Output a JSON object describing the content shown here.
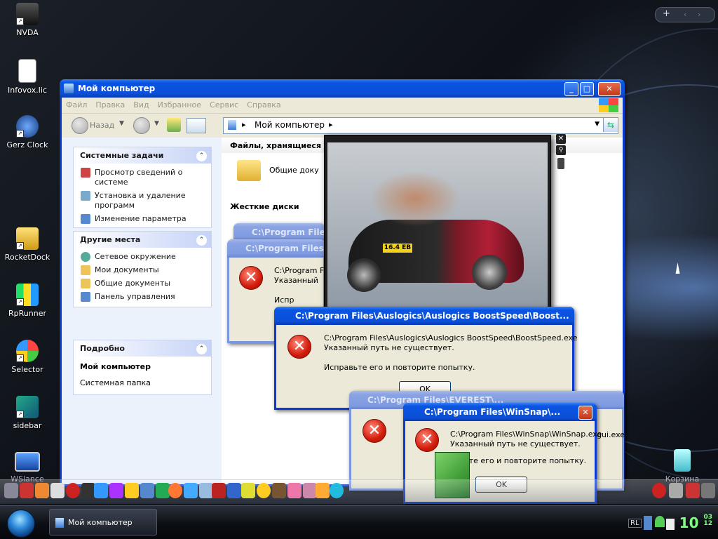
{
  "desktop_icons": [
    {
      "label": "NVDA",
      "icon": "nvda-icon"
    },
    {
      "label": "Infovox.lic",
      "icon": "document-icon"
    },
    {
      "label": "Gerz Clock",
      "icon": "clock-icon"
    },
    {
      "label": "RocketDock",
      "icon": "rocketdock-icon"
    },
    {
      "label": "RpRunner",
      "icon": "rprunner-icon"
    },
    {
      "label": "Selector",
      "icon": "windows-orb-icon"
    },
    {
      "label": "sidebar",
      "icon": "sidebar-icon"
    },
    {
      "label": "WSlance",
      "icon": "monitor-icon"
    },
    {
      "label": "Корзина",
      "icon": "recycle-bin-icon"
    }
  ],
  "explorer": {
    "title": "Мой компьютер",
    "menu": [
      "Файл",
      "Правка",
      "Вид",
      "Избранное",
      "Сервис",
      "Справка"
    ],
    "back_label": "Назад",
    "address": "Мой компьютер",
    "groups": [
      {
        "title": "Системные задачи",
        "items": [
          "Просмотр сведений о системе",
          "Установка и удаление программ",
          "Изменение параметра"
        ]
      },
      {
        "title": "Другие места",
        "items": [
          "Сетевое окружение",
          "Мои документы",
          "Общие документы",
          "Панель управления"
        ]
      },
      {
        "title": "Подробно",
        "items": [
          "Мой компьютер",
          "Системная папка"
        ]
      }
    ],
    "content_header": "Файлы, хранящиеся",
    "shared_docs": "Общие доку",
    "hard_drives": "Жесткие диски"
  },
  "dialogs": {
    "boost": {
      "title": "C:\\Program Files\\Auslogics\\Auslogics BoostSpeed\\Boost...",
      "path": "C:\\Program Files\\Auslogics\\Auslogics BoostSpeed\\BoostSpeed.exe",
      "message": "Указанный путь не существует.",
      "hint": "Исправьте его и повторите попытку.",
      "ok": "OK"
    },
    "winsnap": {
      "title": "C:\\Program Files\\WinSnap\\...",
      "path": "C:\\Program Files\\WinSnap\\WinSnap.exe",
      "message": "Указанный путь не существует.",
      "hint": "равьте его и повторите попытку.",
      "ok": "OK"
    },
    "back1": {
      "title": "C:\\Program Files\\",
      "path": "C:\\Program Files\\",
      "message": "Указанный",
      "hint": "Испр"
    },
    "back2": {
      "title": "C:\\Program Files\\A"
    },
    "everest": {
      "title": "C:\\Program Files\\EVEREST\\...",
      "tail": "gui.exe"
    }
  },
  "viewer": {
    "plate": "16.4 EB"
  },
  "taskbar": {
    "task": "Мой компьютер",
    "lang": "RL",
    "time": "10",
    "time_small_top": "03",
    "time_small_bottom": "12"
  },
  "colors": {
    "xp_blue": "#0a54e3",
    "error_red": "#d21b0b",
    "clock_green": "#7fff7f"
  }
}
